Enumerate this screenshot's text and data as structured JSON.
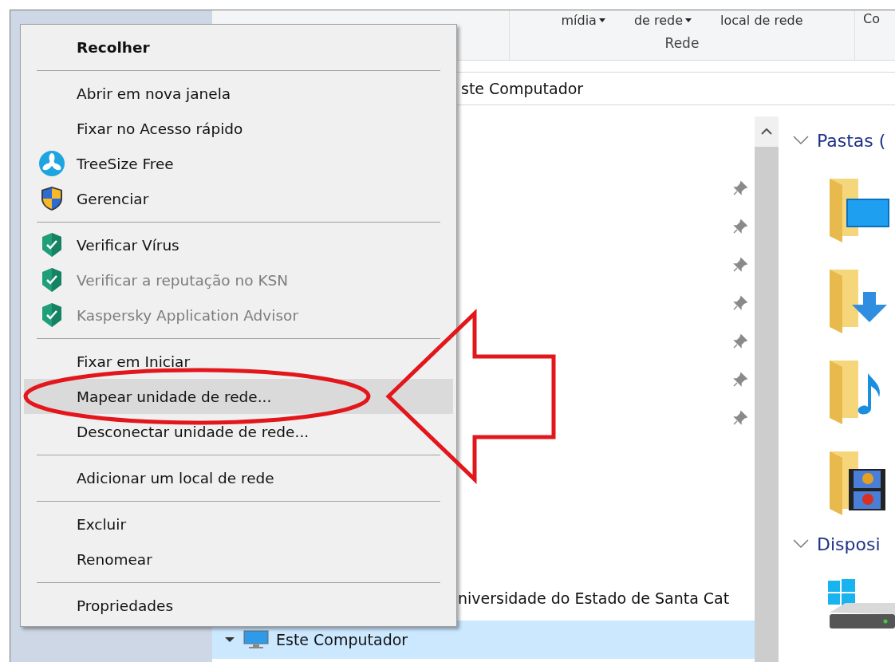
{
  "ribbon": {
    "buttons": [
      {
        "label": "mídia",
        "dropdown": true
      },
      {
        "label": "de rede",
        "dropdown": true
      },
      {
        "label": "local de rede",
        "dropdown": false
      },
      {
        "label": "Co",
        "dropdown": false
      }
    ],
    "group_label": "Rede"
  },
  "address_bar": {
    "path": "ste Computador"
  },
  "nav_pane": {
    "quick_access_rows": [
      {
        "pinned": true
      },
      {
        "pinned": true
      },
      {
        "pinned": true
      },
      {
        "pinned": true
      },
      {
        "pinned": true
      },
      {
        "pinned": true
      },
      {
        "pinned": true
      }
    ],
    "rows": [
      {
        "kind": "link",
        "label": "niversidade do Estado de Santa Cat",
        "selected": false
      },
      {
        "kind": "computer",
        "label": "Este Computador",
        "selected": true
      }
    ]
  },
  "content": {
    "sections": [
      {
        "title": "Pastas (",
        "items": [
          {
            "kind": "desktop"
          },
          {
            "kind": "downloads"
          },
          {
            "kind": "music"
          },
          {
            "kind": "videos"
          }
        ]
      },
      {
        "title": "Disposi",
        "items": [
          {
            "kind": "drive"
          }
        ]
      }
    ]
  },
  "context_menu": {
    "groups": [
      [
        {
          "kind": "plain",
          "label": "Recolher",
          "default": true,
          "disabled": false,
          "selected": false
        }
      ],
      [
        {
          "kind": "plain",
          "label": "Abrir em nova janela",
          "default": false,
          "disabled": false,
          "selected": false
        },
        {
          "kind": "plain",
          "label": "Fixar no Acesso rápido",
          "default": false,
          "disabled": false,
          "selected": false
        },
        {
          "kind": "treesize",
          "label": "TreeSize Free",
          "default": false,
          "disabled": false,
          "selected": false
        },
        {
          "kind": "uac",
          "label": "Gerenciar",
          "default": false,
          "disabled": false,
          "selected": false
        }
      ],
      [
        {
          "kind": "kaspersky",
          "label": "Verificar Vírus",
          "default": false,
          "disabled": false,
          "selected": false
        },
        {
          "kind": "kaspersky",
          "label": "Verificar a reputação no KSN",
          "default": false,
          "disabled": true,
          "selected": false
        },
        {
          "kind": "kaspersky",
          "label": "Kaspersky Application Advisor",
          "default": false,
          "disabled": true,
          "selected": false
        }
      ],
      [
        {
          "kind": "plain",
          "label": "Fixar em Iniciar",
          "default": false,
          "disabled": false,
          "selected": false
        },
        {
          "kind": "plain",
          "label": "Mapear unidade de rede...",
          "default": false,
          "disabled": false,
          "selected": true
        },
        {
          "kind": "plain",
          "label": "Desconectar unidade de rede...",
          "default": false,
          "disabled": false,
          "selected": false
        }
      ],
      [
        {
          "kind": "plain",
          "label": "Adicionar um local de rede",
          "default": false,
          "disabled": false,
          "selected": false
        }
      ],
      [
        {
          "kind": "plain",
          "label": "Excluir",
          "default": false,
          "disabled": false,
          "selected": false
        },
        {
          "kind": "plain",
          "label": "Renomear",
          "default": false,
          "disabled": false,
          "selected": false
        }
      ],
      [
        {
          "kind": "plain",
          "label": "Propriedades",
          "default": false,
          "disabled": false,
          "selected": false
        }
      ]
    ]
  }
}
